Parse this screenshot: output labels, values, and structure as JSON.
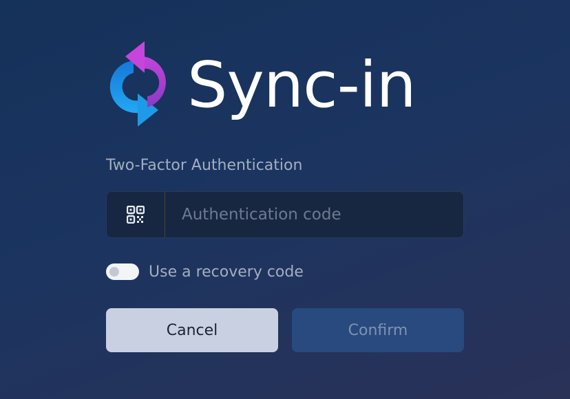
{
  "brand": {
    "name": "Sync-in",
    "logo_icon": "sync-arrows-icon",
    "colors": {
      "gradient_blue": "#1ea0f0",
      "gradient_purple": "#b33fd0"
    }
  },
  "form": {
    "title": "Two-Factor Authentication",
    "code_field": {
      "placeholder": "Authentication code",
      "value": "",
      "addon_icon": "qr-code-icon"
    },
    "recovery_toggle": {
      "label": "Use a recovery code",
      "checked": false
    },
    "buttons": {
      "cancel_label": "Cancel",
      "confirm_label": "Confirm",
      "confirm_disabled": true
    }
  },
  "colors": {
    "background": "#1b3460",
    "cancel_bg": "#c8d0e2",
    "confirm_bg": "#284a7e"
  }
}
